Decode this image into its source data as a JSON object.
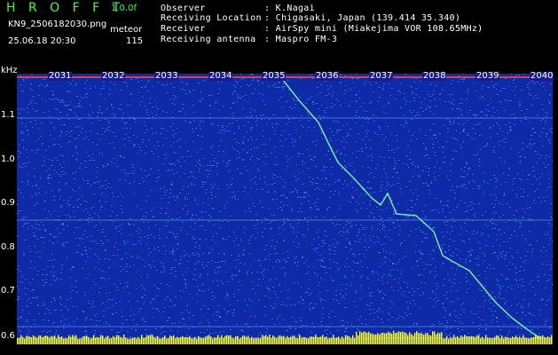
{
  "header": {
    "brand": "H R O F F T",
    "version": "1.0.0f",
    "filename": "KN9_2506182030.png",
    "mode": "meteor",
    "datetime": "25.06.18 20:30",
    "count": "115",
    "info": [
      {
        "label": "Observer",
        "value": ": K.Nagai"
      },
      {
        "label": "Receiving Location",
        "value": ": Chigasaki, Japan (139.414 35.340)"
      },
      {
        "label": "Receiver",
        "value": ": AirSpy mini (Miakejima VOR 108.65MHz)"
      },
      {
        "label": "Receiving antenna",
        "value": ": Maspro FM-3"
      }
    ]
  },
  "axis": {
    "unit": "kHz",
    "y_ticks": [
      "1.1",
      "1.0",
      "0.9",
      "0.8",
      "0.7",
      "0.6"
    ],
    "x_ticks": [
      "2031",
      "2032",
      "2033",
      "2034",
      "2035",
      "2036",
      "2037",
      "2038",
      "2039",
      "2040"
    ]
  },
  "colors": {
    "background": "#0e2aa6",
    "noise": "#3c7cff",
    "trace": "#7cff9a",
    "carrier": "#ff4040",
    "bottom_band": "#ffff20"
  }
}
